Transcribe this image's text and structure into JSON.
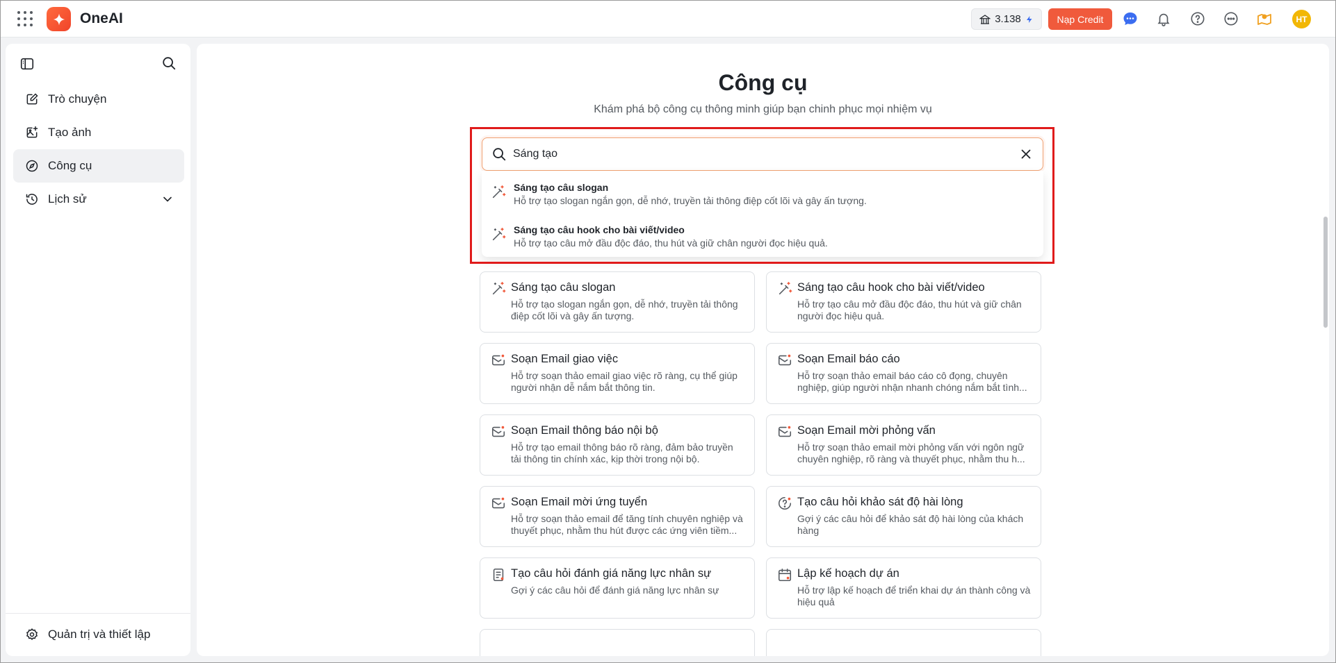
{
  "header": {
    "app_name": "OneAI",
    "credit_amount": "3.138",
    "topup_label": "Nạp Credit",
    "avatar_initials": "HT",
    "colors": {
      "brand": "#f05a3c",
      "avatar": "#f2b705",
      "chat": "#3b6df0"
    }
  },
  "sidebar": {
    "items": [
      {
        "label": "Trò chuyện",
        "icon": "edit-icon"
      },
      {
        "label": "Tạo ảnh",
        "icon": "image-icon"
      },
      {
        "label": "Công cụ",
        "icon": "compass-icon",
        "active": true
      },
      {
        "label": "Lịch sử",
        "icon": "history-icon"
      }
    ],
    "settings_label": "Quản trị và thiết lập"
  },
  "main": {
    "title": "Công cụ",
    "subtitle": "Khám phá bộ công cụ thông minh giúp bạn chinh phục mọi nhiệm vụ",
    "search": {
      "value": "Sáng tạo",
      "suggestions": [
        {
          "title": "Sáng tạo câu slogan",
          "desc": "Hỗ trợ tạo slogan ngắn gọn, dễ nhớ, truyền tải thông điệp cốt lõi và gây ấn tượng."
        },
        {
          "title": "Sáng tạo câu hook cho bài viết/video",
          "desc": "Hỗ trợ tạo câu mở đầu độc đáo, thu hút và giữ chân người đọc hiệu quả."
        }
      ]
    },
    "tools": [
      {
        "title": "Sáng tạo câu slogan",
        "desc": "Hỗ trợ tạo slogan ngắn gọn, dễ nhớ, truyền tải thông điệp cốt lõi và gây ấn tượng.",
        "icon": "magic-wand-icon"
      },
      {
        "title": "Sáng tạo câu hook cho bài viết/video",
        "desc": "Hỗ trợ tạo câu mở đầu độc đáo, thu hút và giữ chân người đọc hiệu quả.",
        "icon": "magic-wand-icon"
      },
      {
        "title": "Soạn Email giao việc",
        "desc": "Hỗ trợ soạn thảo email giao việc rõ ràng, cụ thể giúp người nhận dễ nắm bắt thông tin.",
        "icon": "mail-icon"
      },
      {
        "title": "Soạn Email báo cáo",
        "desc": "Hỗ trợ soạn thảo email báo cáo cô đọng, chuyên nghiệp, giúp người nhận nhanh chóng nắm bắt tình...",
        "icon": "mail-icon"
      },
      {
        "title": "Soạn Email thông báo nội bộ",
        "desc": "Hỗ trợ tạo email thông báo rõ ràng, đảm bảo truyền tải thông tin chính xác, kịp thời trong nội bộ.",
        "icon": "mail-icon"
      },
      {
        "title": "Soạn Email mời phỏng vấn",
        "desc": "Hỗ trợ soạn thảo email mời phỏng vấn với ngôn ngữ chuyên nghiệp, rõ ràng và thuyết phục, nhằm thu h...",
        "icon": "mail-icon"
      },
      {
        "title": "Soạn Email mời ứng tuyển",
        "desc": "Hỗ trợ soạn thảo email để tăng tính chuyên nghiệp và thuyết phục, nhằm thu hút được các ứng viên tiềm...",
        "icon": "mail-icon"
      },
      {
        "title": "Tạo câu hỏi khảo sát độ hài lòng",
        "desc": "Gợi ý các câu hỏi để khảo sát độ hài lòng của khách hàng",
        "icon": "survey-icon"
      },
      {
        "title": "Tạo câu hỏi đánh giá năng lực nhân sự",
        "desc": "Gợi ý các câu hỏi để đánh giá năng lực nhân sự",
        "icon": "checklist-icon"
      },
      {
        "title": "Lập kế hoạch dự án",
        "desc": "Hỗ trợ lập kế hoạch để triển khai dự án thành công và hiệu quả",
        "icon": "calendar-icon"
      }
    ]
  }
}
